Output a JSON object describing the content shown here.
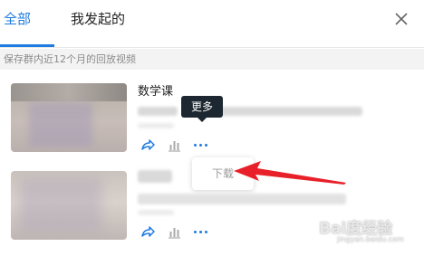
{
  "tabs": [
    {
      "label": "全部",
      "active": true
    },
    {
      "label": "我发起的",
      "active": false
    }
  ],
  "close_icon": "close-icon",
  "notice": "保存群内近12个月的回放视频",
  "items": [
    {
      "title": "数学课",
      "actions": [
        "share-icon",
        "stats-icon",
        "more-icon"
      ]
    },
    {
      "title": "",
      "actions": [
        "share-icon",
        "stats-icon",
        "more-icon"
      ]
    }
  ],
  "tooltip": "更多",
  "menu": {
    "download_label": "下载"
  },
  "colors": {
    "accent": "#1e7be0",
    "tooltip_bg": "#1d2731",
    "arrow": "#e8202a"
  },
  "watermark": {
    "brand": "Bai度经验",
    "url": "jingyan.baidu.com"
  }
}
